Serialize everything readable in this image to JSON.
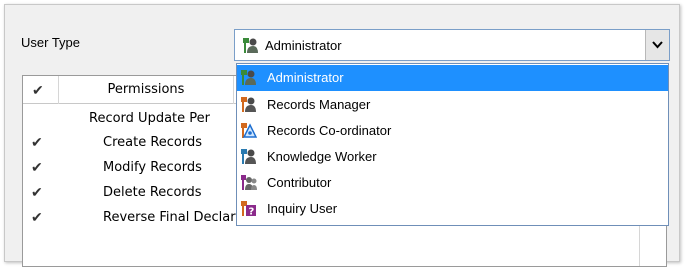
{
  "user_type": {
    "label": "User Type",
    "selected_value": "Administrator",
    "selected_icon": "administrator-icon"
  },
  "dropdown": {
    "options": [
      {
        "label": "Administrator",
        "icon": "administrator-icon",
        "selected": true
      },
      {
        "label": "Records Manager",
        "icon": "records-manager-icon",
        "selected": false
      },
      {
        "label": "Records Co-ordinator",
        "icon": "records-coordinator-icon",
        "selected": false
      },
      {
        "label": "Knowledge Worker",
        "icon": "knowledge-worker-icon",
        "selected": false
      },
      {
        "label": "Contributor",
        "icon": "contributor-icon",
        "selected": false
      },
      {
        "label": "Inquiry User",
        "icon": "inquiry-user-icon",
        "selected": false
      }
    ]
  },
  "permissions_table": {
    "header_check": "✔",
    "header_permissions": "Permissions",
    "rows": [
      {
        "checked": false,
        "text": "Record Update Per"
      },
      {
        "checked": true,
        "text": "Create Records"
      },
      {
        "checked": true,
        "text": "Modify Records"
      },
      {
        "checked": true,
        "text": "Delete Records"
      },
      {
        "checked": true,
        "text": "Reverse Final Declaration"
      }
    ],
    "check_glyph": "✔"
  },
  "colors": {
    "selection": "#1e90ff",
    "admin_green": "#3a8a3a",
    "manager_orange": "#d2691e",
    "coordinator_blue": "#1e6fd0",
    "worker_teal": "#2a7ab0",
    "inquiry_purple": "#8b2a8b"
  }
}
